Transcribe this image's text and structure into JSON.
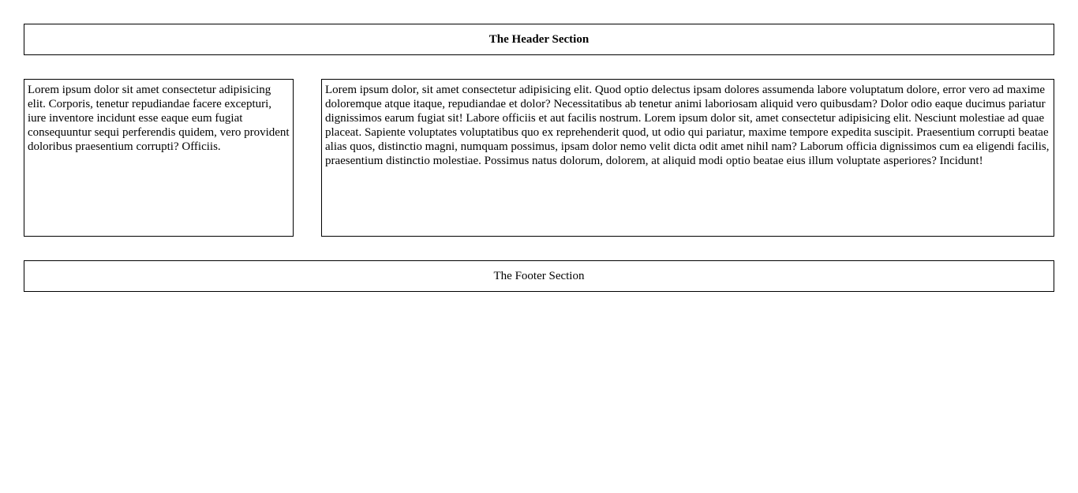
{
  "header": {
    "title": "The Header Section"
  },
  "aside": {
    "text": "Lorem ipsum dolor sit amet consectetur adipisicing elit. Corporis, tenetur repudiandae facere excepturi, iure inventore incidunt esse eaque eum fugiat consequuntur sequi perferendis quidem, vero provident doloribus praesentium corrupti? Officiis."
  },
  "main": {
    "text": "Lorem ipsum dolor, sit amet consectetur adipisicing elit. Quod optio delectus ipsam dolores assumenda labore voluptatum dolore, error vero ad maxime doloremque atque itaque, repudiandae et dolor? Necessitatibus ab tenetur animi laboriosam aliquid vero quibusdam? Dolor odio eaque ducimus pariatur dignissimos earum fugiat sit! Labore officiis et aut facilis nostrum. Lorem ipsum dolor sit, amet consectetur adipisicing elit. Nesciunt molestiae ad quae placeat. Sapiente voluptates voluptatibus quo ex reprehenderit quod, ut odio qui pariatur, maxime tempore expedita suscipit. Praesentium corrupti beatae alias quos, distinctio magni, numquam possimus, ipsam dolor nemo velit dicta odit amet nihil nam? Laborum officia dignissimos cum ea eligendi facilis, praesentium distinctio molestiae. Possimus natus dolorum, dolorem, at aliquid modi optio beatae eius illum voluptate asperiores? Incidunt!"
  },
  "footer": {
    "title": "The Footer Section"
  }
}
